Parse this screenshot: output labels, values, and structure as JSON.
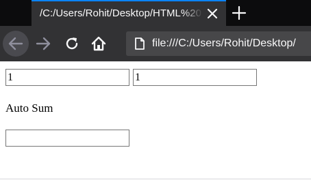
{
  "browser": {
    "tab_title": "/C:/Users/Rohit/Desktop/HTML%20",
    "url": "file:///C:/Users/Rohit/Desktop/",
    "icons": {
      "close": "close-icon",
      "new_tab": "plus-icon",
      "back": "arrow-left-icon",
      "forward": "arrow-right-icon",
      "reload": "reload-icon",
      "home": "home-icon",
      "page": "page-icon"
    }
  },
  "page": {
    "field_a_value": "1",
    "field_b_value": "1",
    "auto_sum_label": "Auto Sum",
    "result_value": ""
  },
  "colors": {
    "tab_accent": "#0a84ff",
    "toolbar_bg": "#323234",
    "tabstrip_bg": "#0c0c0d",
    "urlbar_bg": "#474749"
  }
}
